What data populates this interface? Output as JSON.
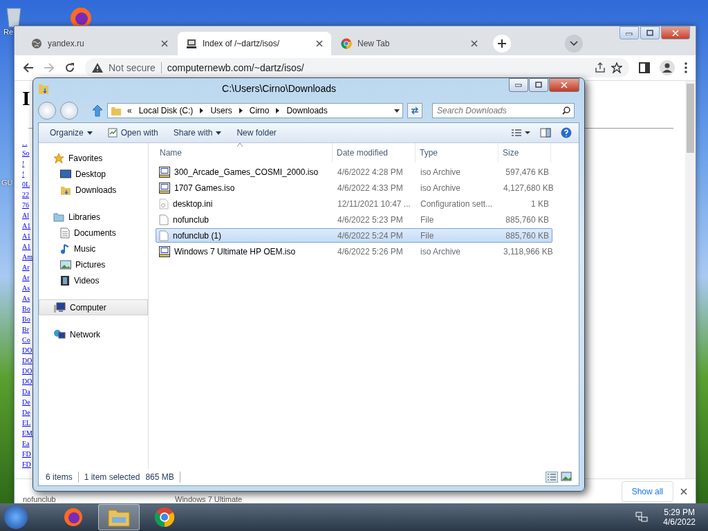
{
  "desktop": {
    "icons": [
      {
        "label": "Re",
        "kind": "bin"
      },
      {
        "label": "GU",
        "kind": "blank"
      }
    ]
  },
  "browser": {
    "tabs": [
      {
        "title": "yandex.ru",
        "selected": false,
        "kind": "globe"
      },
      {
        "title": "Index of /~dartz/isos/",
        "selected": true,
        "kind": "computer"
      },
      {
        "title": "New Tab",
        "selected": false,
        "kind": "chrome"
      }
    ],
    "security": "Not secure",
    "url": "computernewb.com/~dartz/isos/",
    "page": {
      "heading": "I",
      "links": [
        ". .",
        "So",
        "!",
        "!",
        "0L",
        "22",
        "76",
        "Al",
        "A1",
        "A1",
        "A1",
        "Am",
        "Ar",
        "Ar",
        "As",
        "As",
        "Bo",
        "Bo",
        "Br",
        "Co",
        "DO",
        "DO",
        "DO",
        "DO",
        "Da",
        "De",
        "De",
        "EL",
        "EM",
        "Ea",
        "FD",
        "FD"
      ]
    },
    "downloads": {
      "items": [
        "nofunclub",
        "Windows 7 Ultimate"
      ],
      "show_all": "Show all"
    }
  },
  "explorer": {
    "title": "C:\\Users\\Cirno\\Downloads",
    "breadcrumb_prefix": "«",
    "breadcrumb": [
      "Local Disk (C:)",
      "Users",
      "Cirno",
      "Downloads"
    ],
    "search": {
      "placeholder": "Search Downloads"
    },
    "toolbar": [
      {
        "label": "Organize",
        "dropdown": true,
        "kind": "plain"
      },
      {
        "label": "Open with",
        "dropdown": false,
        "kind": "openwith"
      },
      {
        "label": "Share with",
        "dropdown": true,
        "kind": "plain"
      },
      {
        "label": "New folder",
        "dropdown": false,
        "kind": "plain"
      }
    ],
    "nav": [
      {
        "label": "Favorites",
        "kind": "star",
        "selected": false,
        "children": [
          {
            "label": "Desktop",
            "kind": "desktop",
            "selected": false
          },
          {
            "label": "Downloads",
            "kind": "downloads",
            "selected": false
          }
        ]
      },
      {
        "label": "Libraries",
        "kind": "library",
        "selected": false,
        "children": [
          {
            "label": "Documents",
            "kind": "doc",
            "selected": false
          },
          {
            "label": "Music",
            "kind": "music",
            "selected": false
          },
          {
            "label": "Pictures",
            "kind": "pictures",
            "selected": false
          },
          {
            "label": "Videos",
            "kind": "videos",
            "selected": false
          }
        ]
      },
      {
        "label": "Computer",
        "kind": "computer",
        "selected": true
      },
      {
        "label": "Network",
        "kind": "network",
        "selected": false
      }
    ],
    "columns": [
      "Name",
      "Date modified",
      "Type",
      "Size"
    ],
    "files": [
      {
        "name": "300_Arcade_Games_COSMI_2000.iso",
        "date": "4/6/2022 4:28 PM",
        "type": "iso Archive",
        "size": "597,476 KB",
        "kind": "iso",
        "selected": false
      },
      {
        "name": "1707 Games.iso",
        "date": "4/6/2022 4:33 PM",
        "type": "iso Archive",
        "size": "4,127,680 KB",
        "kind": "iso",
        "selected": false
      },
      {
        "name": "desktop.ini",
        "date": "12/11/2021 10:47 ...",
        "type": "Configuration sett...",
        "size": "1 KB",
        "kind": "ini",
        "selected": false
      },
      {
        "name": "nofunclub",
        "date": "4/6/2022 5:23 PM",
        "type": "File",
        "size": "885,760 KB",
        "kind": "file",
        "selected": false
      },
      {
        "name": "nofunclub (1)",
        "date": "4/6/2022 5:24 PM",
        "type": "File",
        "size": "885,760 KB",
        "kind": "file",
        "selected": true
      },
      {
        "name": "Windows 7 Ultimate HP OEM.iso",
        "date": "4/6/2022 5:26 PM",
        "type": "iso Archive",
        "size": "3,118,966 KB",
        "kind": "iso",
        "selected": false
      }
    ],
    "status": {
      "count": "6 items",
      "selection": "1 item selected",
      "size": "865 MB"
    }
  },
  "taskbar": {
    "apps": [
      {
        "kind": "firefox",
        "selected": false
      },
      {
        "kind": "explorer",
        "selected": true
      },
      {
        "kind": "chrome",
        "selected": false
      }
    ],
    "time": "5:29 PM",
    "date": "4/6/2022"
  }
}
